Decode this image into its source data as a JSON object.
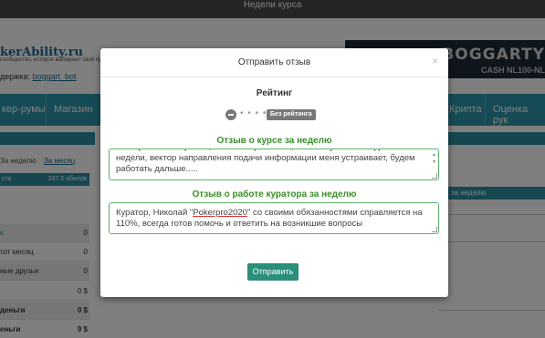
{
  "topbar": {
    "title": "Недели курса"
  },
  "site": {
    "logo": "kerAbility.ru",
    "logo_tagline": "сообщество, которое выбирают свой путь!",
    "support_label": "держка:",
    "support_link": "boggart_bot"
  },
  "banner": {
    "title": "BOGGARTY",
    "subtitle": "CASH NL100-NL"
  },
  "nav": {
    "items": [
      "кер-румы",
      "Магазин",
      "Крипта",
      "Оценка рук"
    ]
  },
  "sidebar": {
    "tab_week": "За неделю",
    "tab_month": "За месяц",
    "stat_label": "ста",
    "stat_value": "337.5 абилок",
    "rows": [
      {
        "label": "к",
        "value": "0"
      },
      {
        "label": "тот месяц",
        "value": "0"
      },
      {
        "label": "ные друзья",
        "value": "0"
      },
      {
        "label": "",
        "value": "0 $"
      },
      {
        "label": "деньги",
        "value": "0 $"
      },
      {
        "label": "еньги",
        "value": "9 $"
      }
    ]
  },
  "right_panel": {
    "label": "за неделю"
  },
  "modal": {
    "title": "Отправить отзыв",
    "close": "×",
    "rating_title": "Рейтинг",
    "rating_dots": "• • • • •",
    "rating_badge": "Без рейтинга",
    "course_label": "Отзыв о курсе за неделю",
    "course_text": "повторения материала, но это скорее плюс, чем минус. Если подвести итог недели, вектор направления подачи информации меня устраивает, будем работать дальше.....",
    "curator_label": "Отзыв о работе куратора за неделю",
    "curator_text_before": "Куратор, Николай \"",
    "curator_text_name": "Pokerpro2020",
    "curator_text_after": "\" со своими обязанностями справляется на 110%, всегда готов помочь и ответить на возникшие вопросы",
    "submit": "Отправить"
  },
  "colors": {
    "accent": "#2d97aa",
    "submit": "#2b8f7c",
    "label_green": "#3b8e2a",
    "field_border": "#5bb26a"
  }
}
